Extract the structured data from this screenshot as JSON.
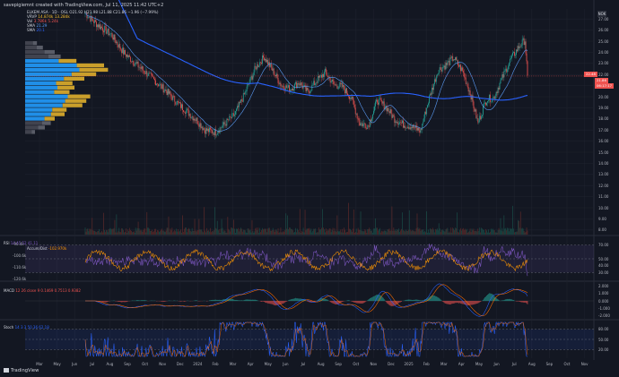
{
  "header": {
    "title": "savepigiemnt created with TradingView.com, Jul 11, 2025 11:42 UTC+2"
  },
  "brand": {
    "label": "TradingView"
  },
  "currency": "NOK",
  "legend": {
    "symbol_line": "ELKEM ASA · 1D · OSL  O21.92 H21.98 L21.88 C21.86 −1.96 (−7.99%)",
    "vrvp": {
      "label": "VRVP",
      "values": "14.874k  13.284k"
    },
    "vol": {
      "label": "Vol",
      "values": "3.786k  5.24k"
    },
    "sma1": {
      "label": "SMA",
      "values": "21.29"
    },
    "sma2": {
      "label": "SMA",
      "values": "20.1"
    }
  },
  "price_axis": {
    "ticks": [
      "27.00",
      "26.00",
      "25.00",
      "24.00",
      "23.00",
      "22.00",
      "21.00",
      "20.00",
      "19.00",
      "18.00",
      "17.00",
      "16.00",
      "15.00",
      "14.00",
      "13.00",
      "12.00",
      "11.00",
      "10.00",
      "9.00",
      "8.00"
    ]
  },
  "price_tags": {
    "last": "21.86",
    "countdown": "06:17:17",
    "high": "22.48"
  },
  "time_axis": {
    "ticks": [
      "Mar",
      "May",
      "Jun",
      "Jul",
      "Aug",
      "Sep",
      "Oct",
      "Nov",
      "Dec",
      "2024",
      "Feb",
      "Mar",
      "Apr",
      "May",
      "Jun",
      "Jul",
      "Aug",
      "Sep",
      "Oct",
      "Nov",
      "Dec",
      "2025",
      "Feb",
      "Mar",
      "Apr",
      "May",
      "Jun",
      "Jul",
      "Aug",
      "Sep",
      "Oct",
      "Nov"
    ]
  },
  "panes": {
    "rsi": {
      "label": "RSI",
      "values": "14  45.52  41.11",
      "ticks": [
        "70.00",
        "50.00",
        "40.00",
        "30.00"
      ],
      "left_ticks": [
        "-90.4k",
        "-100.6k",
        "-110.6k",
        "-120.6k"
      ],
      "sub_label": "Accum/Dist",
      "sub_value": "-102.970k"
    },
    "macd": {
      "label": "MACD",
      "values": "12 26 close 9  0.1469  0.7513  0.9382",
      "ticks": [
        "2.000",
        "1.000",
        "0.000",
        "-1.000",
        "-2.000"
      ]
    },
    "stoch": {
      "label": "Stoch",
      "values": "14 3 3  50.36  62.18",
      "ticks": [
        "80.00",
        "50.00",
        "20.00"
      ]
    }
  },
  "colors": {
    "bg": "#131722",
    "up": "#26a69a",
    "down": "#ef5350",
    "sma_long": "#2962ff",
    "sma_short": "#5b9cf6",
    "vp_value_area": "#2196f3",
    "vp_outside": "#787b86",
    "vp_hl": "#fbc02d",
    "rsi": "#7e57c2",
    "accdist": "#ff9800",
    "stoch_k": "#2962ff",
    "stoch_d": "#ff6d00"
  },
  "chart_data": [
    {
      "type": "candlestick",
      "title": "ELKEM ASA · 1D · OSL",
      "ylim": [
        7.5,
        27.5
      ],
      "x_range": [
        "2023-03",
        "2025-11"
      ],
      "ylabel": "NOK",
      "anchors": [
        [
          0,
          27.5
        ],
        [
          14,
          26.5
        ],
        [
          30,
          25.6
        ],
        [
          44,
          24.0
        ],
        [
          56,
          23.1
        ],
        [
          68,
          22.3
        ],
        [
          82,
          21.3
        ],
        [
          96,
          20.3
        ],
        [
          108,
          19.3
        ],
        [
          118,
          18.6
        ],
        [
          128,
          17.9
        ],
        [
          138,
          17.0
        ],
        [
          150,
          16.8
        ],
        [
          160,
          17.5
        ],
        [
          172,
          18.4
        ],
        [
          182,
          20.0
        ],
        [
          196,
          22.6
        ],
        [
          206,
          23.6
        ],
        [
          216,
          22.3
        ],
        [
          226,
          21.0
        ],
        [
          236,
          20.7
        ],
        [
          246,
          21.3
        ],
        [
          256,
          20.4
        ],
        [
          266,
          21.4
        ],
        [
          276,
          22.2
        ],
        [
          286,
          21.1
        ],
        [
          296,
          20.9
        ],
        [
          306,
          19.9
        ],
        [
          316,
          17.6
        ],
        [
          326,
          17.4
        ],
        [
          336,
          19.7
        ],
        [
          346,
          19.1
        ],
        [
          356,
          18.0
        ],
        [
          366,
          17.5
        ],
        [
          376,
          17.3
        ],
        [
          386,
          16.9
        ],
        [
          396,
          19.9
        ],
        [
          406,
          22.4
        ],
        [
          416,
          22.9
        ],
        [
          424,
          23.5
        ],
        [
          434,
          22.3
        ],
        [
          444,
          20.1
        ],
        [
          452,
          17.6
        ],
        [
          462,
          19.8
        ],
        [
          470,
          19.9
        ],
        [
          480,
          21.7
        ],
        [
          490,
          23.4
        ],
        [
          500,
          24.6
        ],
        [
          506,
          25.1
        ],
        [
          509,
          21.9
        ]
      ],
      "volume_level": "low, spikes in Apr 2024 and Jan 2025"
    },
    {
      "type": "line",
      "name": "SMA",
      "value": 21.29,
      "note": "short SMA"
    },
    {
      "type": "line",
      "name": "SMA",
      "value": 20.1,
      "note": "long SMA"
    },
    {
      "type": "bar",
      "name": "VRVP",
      "note": "volume profile histogram at left, price levels 16.8-24.8",
      "levels": [
        24.8,
        24.4,
        24.0,
        23.6,
        23.2,
        22.8,
        22.4,
        22.0,
        21.6,
        21.2,
        20.8,
        20.4,
        20.0,
        19.6,
        19.2,
        18.8,
        18.4,
        18.0,
        17.6,
        17.2,
        16.8
      ],
      "values": [
        0.12,
        0.18,
        0.3,
        0.36,
        0.52,
        0.8,
        0.84,
        0.72,
        0.6,
        0.48,
        0.5,
        0.45,
        0.66,
        0.62,
        0.58,
        0.42,
        0.4,
        0.3,
        0.26,
        0.2,
        0.1
      ]
    },
    {
      "type": "line",
      "name": "RSI",
      "ylim": [
        20,
        80
      ],
      "last": 45.52
    },
    {
      "type": "line",
      "name": "Accum/Dist",
      "last": -102970
    },
    {
      "type": "line",
      "name": "MACD",
      "ylim": [
        -2.2,
        2.2
      ],
      "values": [
        0.1469,
        0.7513,
        0.9382
      ]
    },
    {
      "type": "line",
      "name": "Stoch",
      "ylim": [
        0,
        100
      ],
      "values": [
        50.36,
        62.18
      ]
    }
  ]
}
